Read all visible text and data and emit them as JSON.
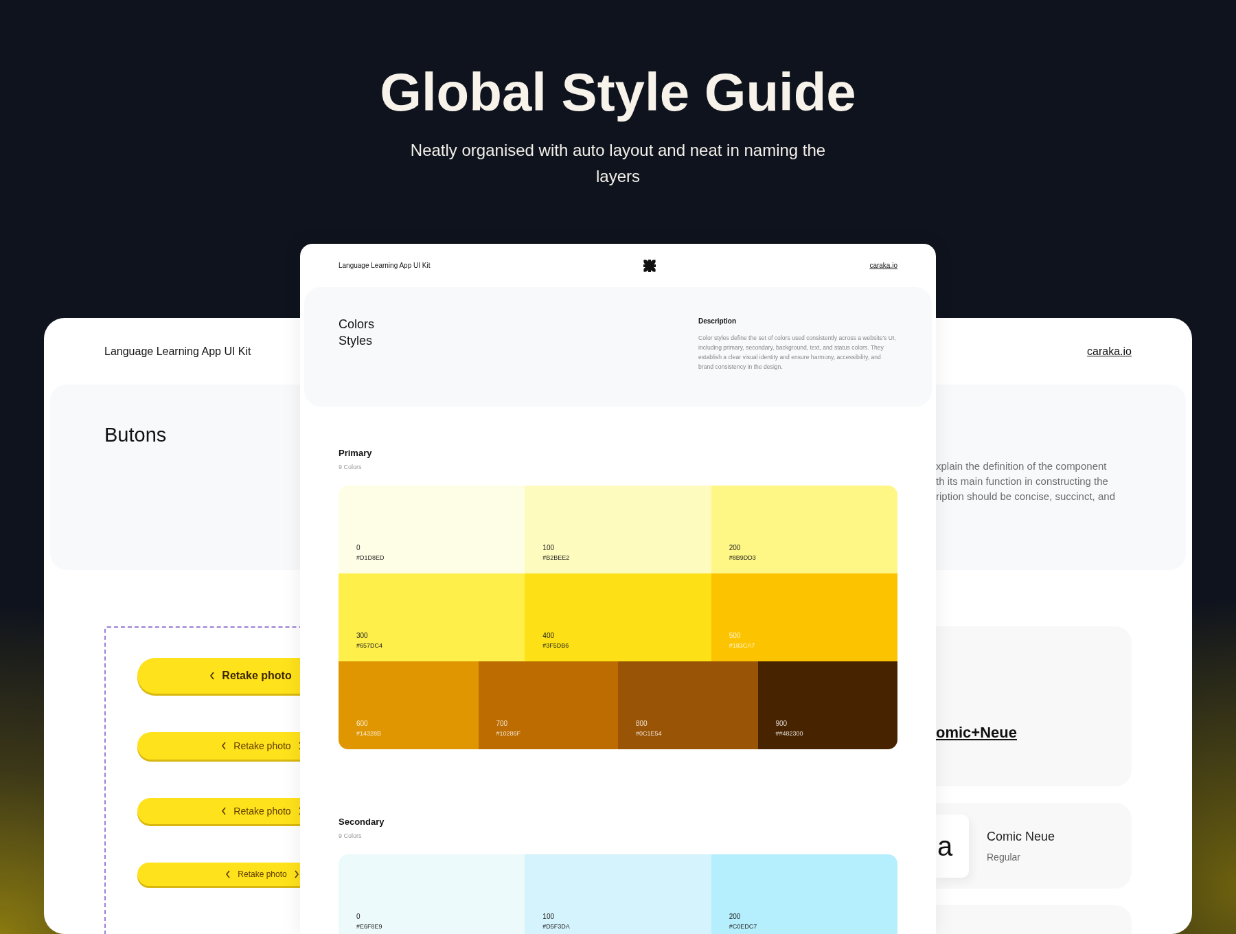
{
  "hero": {
    "title": "Global Style Guide",
    "subtitle": "Neatly organised with auto layout and neat in naming the layers"
  },
  "back_page": {
    "kit_name": "Language Learning App UI Kit",
    "site_link": "caraka.io",
    "section_title": "Butons",
    "description_lines": [
      "xplain the definition of the component",
      "th its main function in constructing the",
      "ription should be concise, succinct, and"
    ],
    "buttons": [
      {
        "label": "Retake photo",
        "kind": "large",
        "trailing_chevron": false
      },
      {
        "label": "Retake photo",
        "kind": "medium",
        "trailing_chevron": true
      },
      {
        "label": "Retake photo",
        "kind": "small",
        "trailing_chevron": true
      },
      {
        "label": "Retake photo",
        "kind": "tiny",
        "trailing_chevron": true
      }
    ],
    "font_link": "omic+Neue",
    "font_sample": {
      "glyph": "a",
      "name": "Comic Neue",
      "weight": "Regular"
    }
  },
  "front_page": {
    "kit_name": "Language Learning App UI Kit",
    "site_link": "caraka.io",
    "section_title": "Colors Styles",
    "description_title": "Description",
    "description": "Color styles define the set of colors used consistently across a website's UI, including primary, secondary, background, text, and status colors. They establish a clear visual identity and ensure harmony, accessibility, and brand consistency in the design.",
    "palettes": [
      {
        "name": "Primary",
        "count": "9 Colors",
        "rows": [
          [
            {
              "step": "0",
              "hex": "#D1D8ED",
              "color": "#fefee6"
            },
            {
              "step": "100",
              "hex": "#B2BEE2",
              "color": "#fefbbe"
            },
            {
              "step": "200",
              "hex": "#8B9DD3",
              "color": "#fef786"
            }
          ],
          [
            {
              "step": "300",
              "hex": "#657DC4",
              "color": "#feef4a"
            },
            {
              "step": "400",
              "hex": "#3F5DB6",
              "color": "#fde116"
            },
            {
              "step": "500",
              "hex": "#183CA7",
              "color": "#fcc400"
            }
          ],
          [
            {
              "step": "600",
              "hex": "#14328B",
              "color": "#e09600"
            },
            {
              "step": "700",
              "hex": "#10286F",
              "color": "#bc6c00"
            },
            {
              "step": "800",
              "hex": "#0C1E54",
              "color": "#9a5406"
            },
            {
              "step": "900",
              "hex": "##482300",
              "color": "#482300"
            }
          ]
        ]
      },
      {
        "name": "Secondary",
        "count": "9 Colors",
        "rows": [
          [
            {
              "step": "0",
              "hex": "#E6F8E9",
              "color": "#ecfafb"
            },
            {
              "step": "100",
              "hex": "#D5F3DA",
              "color": "#d5f3fc"
            },
            {
              "step": "200",
              "hex": "#C0EDC7",
              "color": "#b5eefc"
            }
          ]
        ]
      }
    ]
  }
}
